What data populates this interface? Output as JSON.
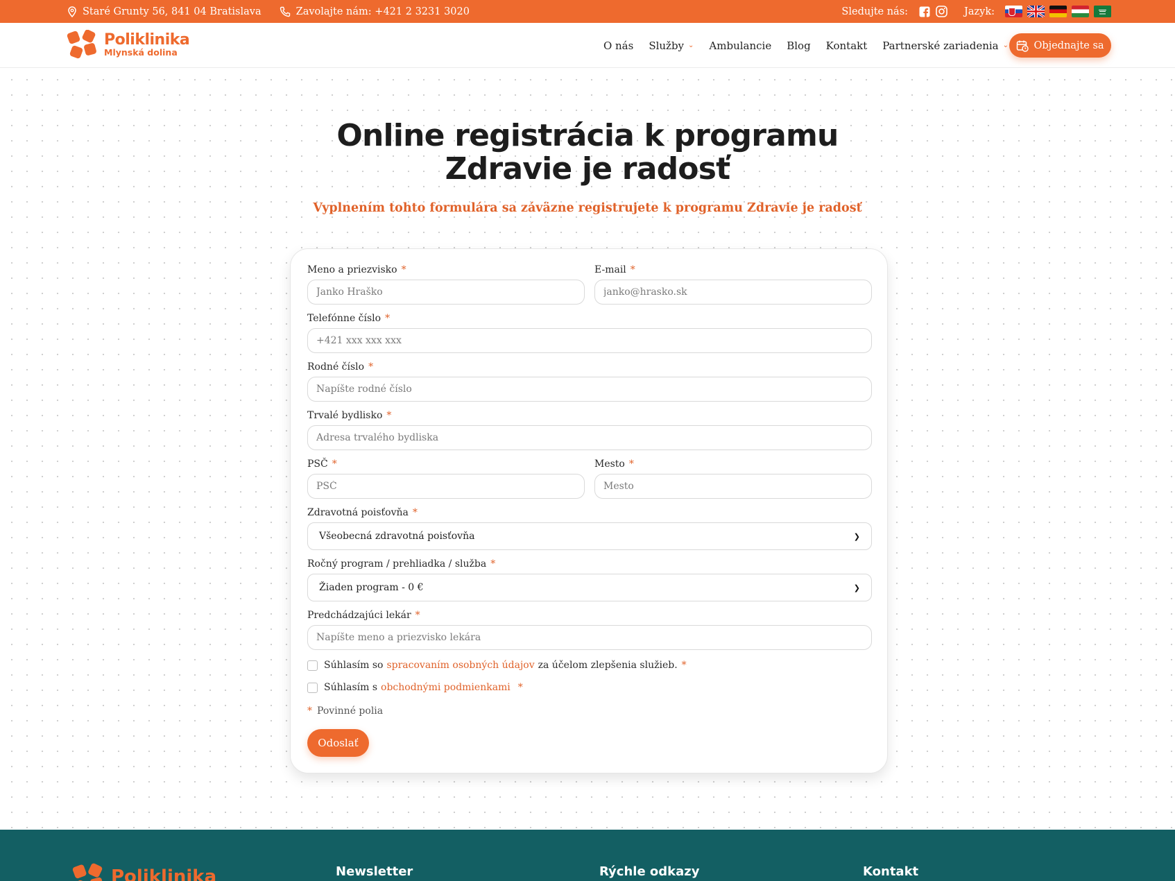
{
  "topbar": {
    "address": "Staré Grunty 56, 841 04 Bratislava",
    "phone_label": "Zavolajte nám:",
    "phone": "+421 2 3231 3020",
    "follow_label": "Sledujte nás:",
    "language_label": "Jazyk:",
    "icons": [
      "location-icon",
      "phone-icon",
      "facebook-icon",
      "instagram-icon"
    ],
    "languages": [
      "sk",
      "en",
      "de",
      "hu",
      "ar"
    ]
  },
  "header": {
    "logo_main": "Poliklinika",
    "logo_sub": "Mlynská dolina",
    "nav": {
      "about": "O nás",
      "services": "Služby",
      "clinics": "Ambulancie",
      "blog": "Blog",
      "contact": "Kontakt",
      "partners": "Partnerské zariadenia"
    },
    "cta_label": "Objednajte sa"
  },
  "hero": {
    "title_line1": "Online registrácia k programu",
    "title_line2": "Zdravie je radosť",
    "subtitle": "Vyplnením tohto formulára sa záväzne registrujete k programu Zdravie je radosť"
  },
  "form": {
    "name": {
      "label": "Meno a priezvisko",
      "placeholder": "Janko Hraško"
    },
    "email": {
      "label": "E-mail",
      "placeholder": "janko@hrasko.sk"
    },
    "phone": {
      "label": "Telefónne číslo",
      "placeholder": "+421 xxx xxx xxx"
    },
    "birth_number": {
      "label": "Rodné číslo",
      "placeholder": "Napíšte rodné číslo"
    },
    "address": {
      "label": "Trvalé bydlisko",
      "placeholder": "Adresa trvalého bydliska"
    },
    "zip": {
      "label": "PSČ",
      "placeholder": "PSČ"
    },
    "city": {
      "label": "Mesto",
      "placeholder": "Mesto"
    },
    "insurance": {
      "label": "Zdravotná poisťovňa",
      "value": "Všeobecná zdravotná poisťovňa"
    },
    "program": {
      "label": "Ročný program / prehliadka / služba",
      "value": "Žiaden program - 0 €"
    },
    "doctor": {
      "label": "Predchádzajúci lekár",
      "placeholder": "Napíšte meno a priezvisko lekára"
    },
    "consent1": {
      "prefix": "Súhlasím so",
      "link": "spracovaním osobných údajov",
      "suffix": "za účelom zlepšenia služieb."
    },
    "consent2": {
      "prefix": "Súhlasím s",
      "link": "obchodnými podmienkami"
    },
    "required_mark": "*",
    "required_note": "Povinné polia",
    "submit_label": "Odoslať"
  },
  "footer": {
    "logo_text": "Poliklinika",
    "newsletter": "Newsletter",
    "quick_links": "Rýchle odkazy",
    "contact": "Kontakt"
  },
  "colors": {
    "accent": "#ee6a2e",
    "footer_bg": "#135f63"
  }
}
